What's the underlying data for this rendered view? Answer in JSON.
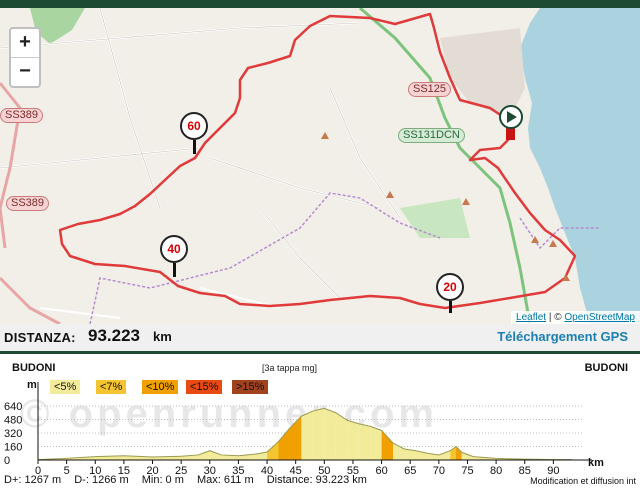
{
  "map": {
    "zoom_in_label": "+",
    "zoom_out_label": "−",
    "road_labels": [
      "SS389",
      "SS389",
      "SS125",
      "SS131DCN"
    ],
    "km_markers": [
      "20",
      "40",
      "60"
    ],
    "attribution_leaflet": "Leaflet",
    "attribution_sep": " | © ",
    "attribution_osm": "OpenStreetMap"
  },
  "distance": {
    "label": "DISTANZA:",
    "value": "93.223",
    "unit": "km",
    "gps_link": "Téléchargement GPS"
  },
  "profile": {
    "start_place": "BUDONI",
    "end_place": "BUDONI",
    "stage_name": "[3a tappa mg]",
    "y_unit": "m",
    "x_unit": "km",
    "legend": [
      {
        "label": "<5%",
        "color": "#f2ec9a"
      },
      {
        "label": "<7%",
        "color": "#f5c531"
      },
      {
        "label": "<10%",
        "color": "#f0a000"
      },
      {
        "label": "<15%",
        "color": "#e84a12"
      },
      {
        "label": ">15%",
        "color": "#a0421c"
      }
    ],
    "y_ticks": [
      "640",
      "480",
      "320",
      "160",
      "0"
    ],
    "x_ticks": [
      "0",
      "5",
      "10",
      "15",
      "20",
      "25",
      "30",
      "35",
      "40",
      "45",
      "50",
      "55",
      "60",
      "65",
      "70",
      "75",
      "80",
      "85",
      "90"
    ],
    "watermark": "© openrunner.com",
    "stats": {
      "d_plus": "D+: 1267 m",
      "d_minus": "D-: 1266 m",
      "min": "Min: 0 m",
      "max": "Max: 611 m",
      "distance": "Distance: 93.223 km"
    },
    "copyright": "Modification et diffusion int"
  },
  "chart_data": {
    "type": "area",
    "xlabel": "km",
    "ylabel": "m",
    "xlim": [
      0,
      95
    ],
    "ylim": [
      0,
      640
    ],
    "x": [
      0,
      5,
      10,
      15,
      20,
      25,
      28,
      30,
      32,
      35,
      38,
      40,
      42,
      44,
      46,
      48,
      50,
      52,
      54,
      56,
      58,
      60,
      62,
      64,
      66,
      68,
      70,
      72,
      73,
      74,
      76,
      78,
      80,
      82,
      85,
      88,
      90,
      93.2
    ],
    "values": [
      5,
      20,
      40,
      50,
      35,
      45,
      60,
      110,
      60,
      50,
      70,
      95,
      220,
      380,
      520,
      580,
      611,
      560,
      470,
      430,
      400,
      350,
      200,
      130,
      110,
      80,
      60,
      110,
      160,
      90,
      40,
      30,
      20,
      15,
      10,
      8,
      5,
      5
    ]
  }
}
